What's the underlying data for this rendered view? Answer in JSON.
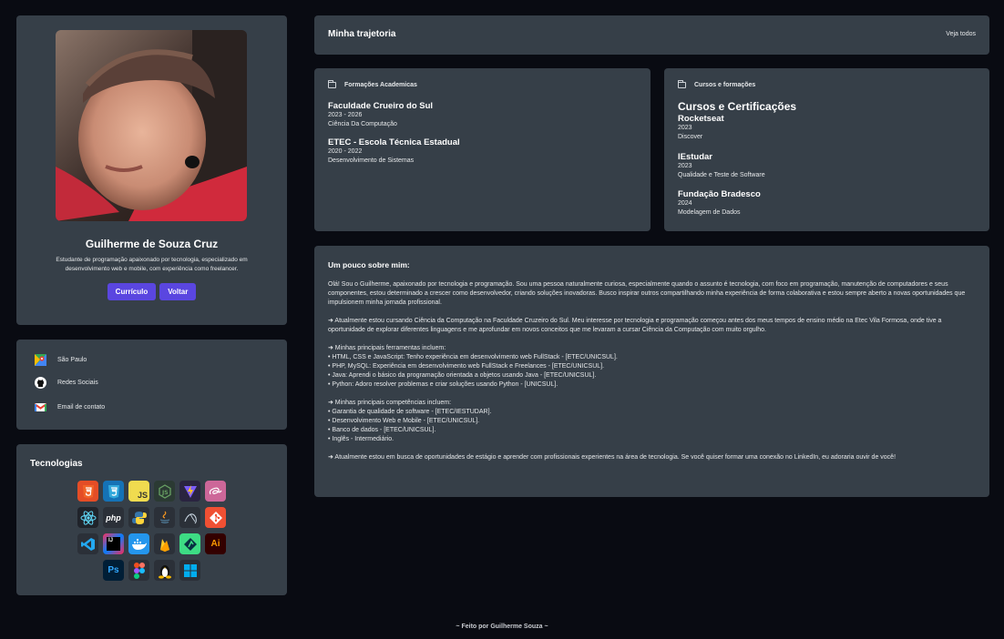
{
  "profile": {
    "name": "Guilherme de Souza Cruz",
    "bio": "Estudante de programação apaixonado por tecnologia, especializado em desenvolvimento web e mobile, com experiência como freelancer.",
    "buttons": {
      "curriculo": "Currículo",
      "voltar": "Voltar"
    },
    "accent": "#5a46e0"
  },
  "links": [
    {
      "label": "São Paulo",
      "icon": "google-maps-icon"
    },
    {
      "label": "Redes Sociais",
      "icon": "github-icon"
    },
    {
      "label": "Email de contato",
      "icon": "gmail-icon"
    }
  ],
  "tech": {
    "title": "Tecnologias",
    "rows": [
      [
        "html5-icon",
        "css3-icon",
        "javascript-icon",
        "nodejs-icon",
        "vite-icon",
        "sass-icon"
      ],
      [
        "react-icon",
        "php-icon",
        "python-icon",
        "java-icon",
        "mysql-icon",
        "git-icon"
      ],
      [
        "vscode-icon",
        "intellij-icon",
        "docker-icon",
        "firebase-icon",
        "android-studio-icon",
        "illustrator-icon"
      ],
      [
        "photoshop-icon",
        "figma-icon",
        "linux-icon",
        "windows-icon"
      ]
    ],
    "glyphs": {
      "javascript": "JS",
      "php": "php",
      "illustrator": "Ai",
      "photoshop": "Ps",
      "intellij": "IJ"
    }
  },
  "trajetoria": {
    "title": "Minha trajetoria",
    "link": "Veja todos"
  },
  "formacoes": {
    "header": "Formações Academicas",
    "items": [
      {
        "title": "Faculdade Crueiro do Sul",
        "years": "2023 - 2026",
        "course": "Ciência Da Computação"
      },
      {
        "title": "ETEC - Escola Técnica Estadual",
        "years": "2020 - 2022",
        "course": "Desenvolvimento de Sistemas"
      }
    ]
  },
  "cursos": {
    "header": "Cursos e formações",
    "title": "Cursos e Certificações",
    "items": [
      {
        "title": "Rocketseat",
        "year": "2023",
        "course": "Discover"
      },
      {
        "title": "IEstudar",
        "year": "2023",
        "course": "Qualidade e Teste de Software"
      },
      {
        "title": "Fundação Bradesco",
        "year": "2024",
        "course": "Modelagem de Dados"
      }
    ]
  },
  "sobre": {
    "title": "Um pouco sobre mim:",
    "p1": "Olá! Sou o Guilherme, apaixonado por tecnologia e programação. Sou uma pessoa naturalmente curiosa, especialmente quando o assunto é tecnologia, com foco em programação, manutenção de computadores e seus componentes, estou determinado a crescer como desenvolvedor, criando soluções inovadoras. Busco inspirar outros compartilhando minha experiência de forma colaborativa e estou sempre aberto a novas oportunidades que impulsionem minha jornada profissional.",
    "p2": "➜ Atualmente estou cursando Ciência da Computação na Faculdade Cruzeiro do Sul. Meu interesse por tecnologia e programação começou antes dos meus tempos de ensino médio na Etec Vila Formosa, onde tive a oportunidade de explorar diferentes linguagens e me aprofundar em novos conceitos que me levaram a cursar Ciência da Computação com muito orgulho.",
    "tools_title": "➜ Minhas principais ferramentas incluem:",
    "tools": [
      "• HTML, CSS e JavaScript: Tenho experiência em desenvolvimento web FullStack - [ETEC/UNICSUL].",
      "• PHP, MySQL: Experiência em desenvolvimento web FullStack e Freelances - [ETEC/UNICSUL].",
      "• Java: Aprendi o básico da programação orientada a objetos usando Java - [ETEC/UNICSUL].",
      "• Python: Adoro resolver problemas e criar soluções usando Python - [UNICSUL]."
    ],
    "skills_title": "➜ Minhas principais competências incluem:",
    "skills": [
      "• Garantia de qualidade de software - [ETEC/IESTUDAR].",
      "• Desenvolvimento Web e Mobile - [ETEC/UNICSUL].",
      "• Banco de dados - [ETEC/UNICSUL].",
      "• Inglês - Intermediário."
    ],
    "p3": "➜ Atualmente estou em busca de oportunidades de estágio e aprender com profissionais experientes na área de tecnologia. Se você quiser formar uma conexão no LinkedIn, eu adoraria ouvir de você!"
  },
  "footer": "~ Feito por Guilherme Souza ~"
}
